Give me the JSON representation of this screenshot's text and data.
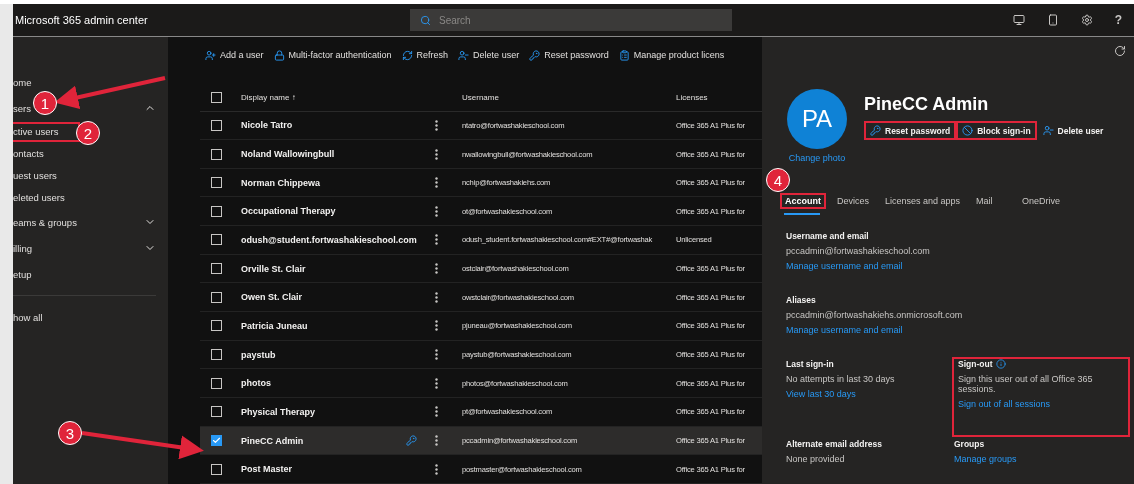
{
  "app": {
    "title": "Microsoft 365 admin center",
    "search": {
      "placeholder": "Search"
    },
    "help": "?"
  },
  "sidebar": {
    "items": [
      {
        "label": "ome",
        "kind": "link"
      },
      {
        "label": "sers",
        "kind": "group",
        "expanded": true,
        "children": [
          {
            "label": "ctive users",
            "outlined": true
          },
          {
            "label": "ontacts",
            "outlined": false
          },
          {
            "label": "uest users",
            "outlined": false
          },
          {
            "label": "eleted users",
            "outlined": false
          }
        ]
      },
      {
        "label": "eams & groups",
        "kind": "group",
        "expanded": false
      },
      {
        "label": "illing",
        "kind": "group",
        "expanded": false
      },
      {
        "label": "etup",
        "kind": "link"
      },
      {
        "label": "how all",
        "kind": "more"
      }
    ]
  },
  "toolbar": [
    {
      "label": "Add a user"
    },
    {
      "label": "Multi-factor authentication"
    },
    {
      "label": "Refresh"
    },
    {
      "label": "Delete user"
    },
    {
      "label": "Reset password"
    },
    {
      "label": "Manage product licens"
    }
  ],
  "table": {
    "columns": [
      "Display name ↑",
      "Username",
      "Licenses"
    ],
    "all_selected": false,
    "rows": [
      {
        "name": "Nicole Tatro",
        "username": "ntatro@fortwashakieschool.com",
        "license": "Office 365 A1 Plus for",
        "selected": false
      },
      {
        "name": "Noland Wallowingbull",
        "username": "nwallowingbull@fortwashakieschool.com",
        "license": "Office 365 A1 Plus for",
        "selected": false
      },
      {
        "name": "Norman Chippewa",
        "username": "nchip@fortwashakiehs.com",
        "license": "Office 365 A1 Plus for",
        "selected": false
      },
      {
        "name": "Occupational Therapy",
        "username": "ot@fortwashakieschool.com",
        "license": "Office 365 A1 Plus for",
        "selected": false
      },
      {
        "name": "odush@student.fortwashakieschool.com",
        "username": "odush_student.fortwashakieschool.com#EXT#@fortwashak",
        "license": "Unlicensed",
        "selected": false
      },
      {
        "name": "Orville St. Clair",
        "username": "ostclair@fortwashakieschool.com",
        "license": "Office 365 A1 Plus for",
        "selected": false
      },
      {
        "name": "Owen St. Clair",
        "username": "owstclair@fortwashakieschool.com",
        "license": "Office 365 A1 Plus for",
        "selected": false
      },
      {
        "name": "Patricia Juneau",
        "username": "pjuneau@fortwashakieschool.com",
        "license": "Office 365 A1 Plus for",
        "selected": false
      },
      {
        "name": "paystub",
        "username": "paystub@fortwashakieschool.com",
        "license": "Office 365 A1 Plus for",
        "selected": false
      },
      {
        "name": "photos",
        "username": "photos@fortwashakieschool.com",
        "license": "Office 365 A1 Plus for",
        "selected": false
      },
      {
        "name": "Physical Therapy",
        "username": "pt@fortwashakieschool.com",
        "license": "Office 365 A1 Plus for",
        "selected": false
      },
      {
        "name": "PineCC Admin",
        "username": "pccadmin@fortwashakieschool.com",
        "license": "Office 365 A1 Plus for",
        "selected": true
      },
      {
        "name": "Post Master",
        "username": "postmaster@fortwashakieschool.com",
        "license": "Office 365 A1 Plus for",
        "selected": false
      }
    ]
  },
  "panel": {
    "initials": "PA",
    "name": "PineCC Admin",
    "change_photo": "Change photo",
    "actions": [
      {
        "label": "Reset password",
        "outlined": true
      },
      {
        "label": "Block sign-in",
        "outlined": true
      },
      {
        "label": "Delete user",
        "outlined": false
      }
    ],
    "tabs": [
      {
        "label": "Account",
        "selected": true,
        "outlined": true
      },
      {
        "label": "Devices",
        "selected": false,
        "outlined": false
      },
      {
        "label": "Licenses and apps",
        "selected": false,
        "outlined": false
      },
      {
        "label": "Mail",
        "selected": false,
        "outlined": false
      },
      {
        "label": "OneDrive",
        "selected": false,
        "outlined": false
      }
    ],
    "sections": [
      {
        "title": "Username and email",
        "kind": "full",
        "outlined": false,
        "info": false,
        "lines": [
          {
            "text": "pccadmin@fortwashakieschool.com",
            "kind": "text"
          },
          {
            "text": "Manage username and email",
            "kind": "link"
          }
        ]
      },
      {
        "title": "Aliases",
        "kind": "full",
        "outlined": false,
        "info": false,
        "lines": [
          {
            "text": "pccadmin@fortwashakiehs.onmicrosoft.com",
            "kind": "text"
          },
          {
            "text": "Manage username and email",
            "kind": "link"
          }
        ]
      },
      {
        "title": "Last sign-in",
        "kind": "half",
        "outlined": false,
        "info": false,
        "lines": [
          {
            "text": "No attempts in last 30 days",
            "kind": "text"
          },
          {
            "text": "View last 30 days",
            "kind": "link"
          }
        ]
      },
      {
        "title": "Sign-out",
        "kind": "half",
        "outlined": true,
        "info": true,
        "lines": [
          {
            "text": "Sign this user out of all Office 365 sessions.",
            "kind": "text"
          },
          {
            "text": "Sign out of all sessions",
            "kind": "link"
          }
        ]
      },
      {
        "title": "Alternate email address",
        "kind": "half",
        "outlined": false,
        "info": false,
        "lines": [
          {
            "text": "None provided",
            "kind": "text"
          }
        ]
      },
      {
        "title": "Groups",
        "kind": "half",
        "outlined": false,
        "info": false,
        "lines": [
          {
            "text": "Manage groups",
            "kind": "link"
          }
        ]
      }
    ]
  },
  "annotations": {
    "markers": [
      "1",
      "2",
      "3",
      "4"
    ]
  }
}
